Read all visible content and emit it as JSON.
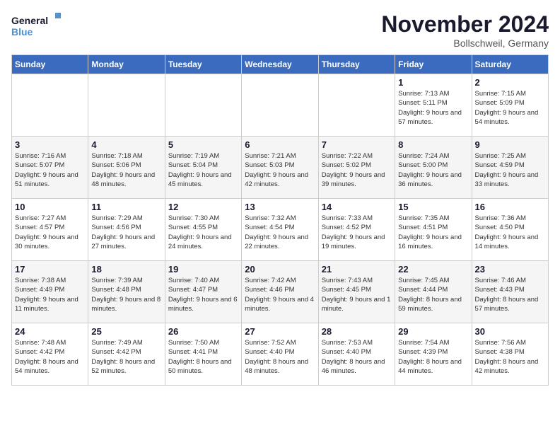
{
  "logo": {
    "line1": "General",
    "line2": "Blue"
  },
  "title": "November 2024",
  "location": "Bollschweil, Germany",
  "days_of_week": [
    "Sunday",
    "Monday",
    "Tuesday",
    "Wednesday",
    "Thursday",
    "Friday",
    "Saturday"
  ],
  "weeks": [
    [
      {
        "day": "",
        "info": ""
      },
      {
        "day": "",
        "info": ""
      },
      {
        "day": "",
        "info": ""
      },
      {
        "day": "",
        "info": ""
      },
      {
        "day": "",
        "info": ""
      },
      {
        "day": "1",
        "info": "Sunrise: 7:13 AM\nSunset: 5:11 PM\nDaylight: 9 hours and 57 minutes."
      },
      {
        "day": "2",
        "info": "Sunrise: 7:15 AM\nSunset: 5:09 PM\nDaylight: 9 hours and 54 minutes."
      }
    ],
    [
      {
        "day": "3",
        "info": "Sunrise: 7:16 AM\nSunset: 5:07 PM\nDaylight: 9 hours and 51 minutes."
      },
      {
        "day": "4",
        "info": "Sunrise: 7:18 AM\nSunset: 5:06 PM\nDaylight: 9 hours and 48 minutes."
      },
      {
        "day": "5",
        "info": "Sunrise: 7:19 AM\nSunset: 5:04 PM\nDaylight: 9 hours and 45 minutes."
      },
      {
        "day": "6",
        "info": "Sunrise: 7:21 AM\nSunset: 5:03 PM\nDaylight: 9 hours and 42 minutes."
      },
      {
        "day": "7",
        "info": "Sunrise: 7:22 AM\nSunset: 5:02 PM\nDaylight: 9 hours and 39 minutes."
      },
      {
        "day": "8",
        "info": "Sunrise: 7:24 AM\nSunset: 5:00 PM\nDaylight: 9 hours and 36 minutes."
      },
      {
        "day": "9",
        "info": "Sunrise: 7:25 AM\nSunset: 4:59 PM\nDaylight: 9 hours and 33 minutes."
      }
    ],
    [
      {
        "day": "10",
        "info": "Sunrise: 7:27 AM\nSunset: 4:57 PM\nDaylight: 9 hours and 30 minutes."
      },
      {
        "day": "11",
        "info": "Sunrise: 7:29 AM\nSunset: 4:56 PM\nDaylight: 9 hours and 27 minutes."
      },
      {
        "day": "12",
        "info": "Sunrise: 7:30 AM\nSunset: 4:55 PM\nDaylight: 9 hours and 24 minutes."
      },
      {
        "day": "13",
        "info": "Sunrise: 7:32 AM\nSunset: 4:54 PM\nDaylight: 9 hours and 22 minutes."
      },
      {
        "day": "14",
        "info": "Sunrise: 7:33 AM\nSunset: 4:52 PM\nDaylight: 9 hours and 19 minutes."
      },
      {
        "day": "15",
        "info": "Sunrise: 7:35 AM\nSunset: 4:51 PM\nDaylight: 9 hours and 16 minutes."
      },
      {
        "day": "16",
        "info": "Sunrise: 7:36 AM\nSunset: 4:50 PM\nDaylight: 9 hours and 14 minutes."
      }
    ],
    [
      {
        "day": "17",
        "info": "Sunrise: 7:38 AM\nSunset: 4:49 PM\nDaylight: 9 hours and 11 minutes."
      },
      {
        "day": "18",
        "info": "Sunrise: 7:39 AM\nSunset: 4:48 PM\nDaylight: 9 hours and 8 minutes."
      },
      {
        "day": "19",
        "info": "Sunrise: 7:40 AM\nSunset: 4:47 PM\nDaylight: 9 hours and 6 minutes."
      },
      {
        "day": "20",
        "info": "Sunrise: 7:42 AM\nSunset: 4:46 PM\nDaylight: 9 hours and 4 minutes."
      },
      {
        "day": "21",
        "info": "Sunrise: 7:43 AM\nSunset: 4:45 PM\nDaylight: 9 hours and 1 minute."
      },
      {
        "day": "22",
        "info": "Sunrise: 7:45 AM\nSunset: 4:44 PM\nDaylight: 8 hours and 59 minutes."
      },
      {
        "day": "23",
        "info": "Sunrise: 7:46 AM\nSunset: 4:43 PM\nDaylight: 8 hours and 57 minutes."
      }
    ],
    [
      {
        "day": "24",
        "info": "Sunrise: 7:48 AM\nSunset: 4:42 PM\nDaylight: 8 hours and 54 minutes."
      },
      {
        "day": "25",
        "info": "Sunrise: 7:49 AM\nSunset: 4:42 PM\nDaylight: 8 hours and 52 minutes."
      },
      {
        "day": "26",
        "info": "Sunrise: 7:50 AM\nSunset: 4:41 PM\nDaylight: 8 hours and 50 minutes."
      },
      {
        "day": "27",
        "info": "Sunrise: 7:52 AM\nSunset: 4:40 PM\nDaylight: 8 hours and 48 minutes."
      },
      {
        "day": "28",
        "info": "Sunrise: 7:53 AM\nSunset: 4:40 PM\nDaylight: 8 hours and 46 minutes."
      },
      {
        "day": "29",
        "info": "Sunrise: 7:54 AM\nSunset: 4:39 PM\nDaylight: 8 hours and 44 minutes."
      },
      {
        "day": "30",
        "info": "Sunrise: 7:56 AM\nSunset: 4:38 PM\nDaylight: 8 hours and 42 minutes."
      }
    ]
  ]
}
